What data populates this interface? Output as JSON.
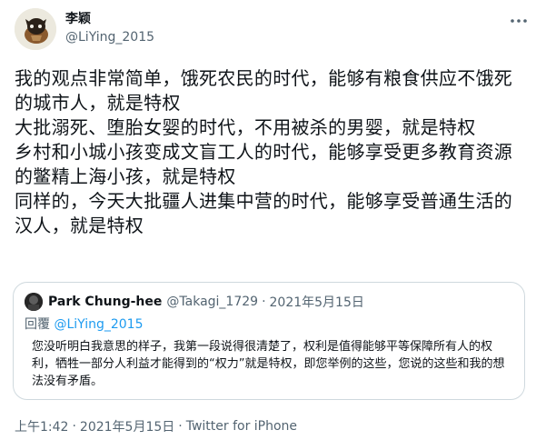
{
  "author": {
    "display_name": "李颖",
    "username": "@LiYing_2015"
  },
  "tweet": {
    "paragraphs": [
      "我的观点非常简单，饿死农民的时代，能够有粮食供应不饿死的城市人，就是特权",
      "大批溺死、堕胎女婴的时代，不用被杀的男婴，就是特权",
      "乡村和小城小孩变成文盲工人的时代，能够享受更多教育资源的鳖精上海小孩，就是特权",
      "同样的，今天大批疆人进集中营的时代，能够享受普通生活的汉人，就是特权"
    ]
  },
  "quote": {
    "display_name": "Park Chung-hee",
    "username": "@Takagi_1729",
    "separator": "·",
    "date": "2021年5月15日",
    "reply_prefix": "回覆",
    "reply_to": "@LiYing_2015",
    "text": "您没听明白我意思的样子，我第一段说得很清楚了，权利是值得能够平等保障所有人的权利，牺牲一部分人利益才能得到的“权力”就是特权，即您举例的这些，您说的这些和我的想法没有矛盾。"
  },
  "footer": {
    "time": "上午1:42",
    "separator": "·",
    "date": "2021年5月15日",
    "source": "Twitter for iPhone"
  },
  "colors": {
    "text": "#0f1419",
    "secondary": "#536471",
    "link": "#1d9bf0",
    "border": "#cfd9de"
  },
  "icons": {
    "more": "more-icon"
  }
}
